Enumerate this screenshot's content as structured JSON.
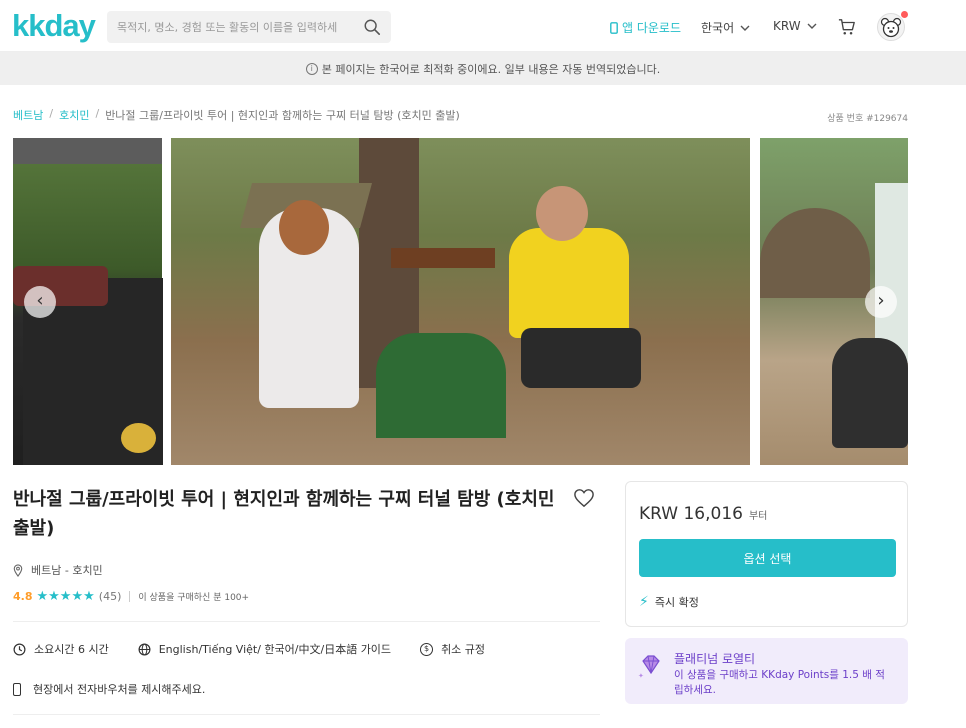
{
  "header": {
    "logo": "kkday",
    "search_placeholder": "목적지, 명소, 경험 또는 활동의 이름을 입력하세",
    "app_download": "앱 다운로드",
    "language": "한국어",
    "currency": "KRW",
    "icons": [
      "search-icon",
      "phone-icon",
      "chevron-down-icon",
      "cart-icon",
      "avatar-bear-icon"
    ]
  },
  "notice": "본 페이지는 한국어로 최적화 중이에요. 일부 내용은 자동 번역되었습니다.",
  "breadcrumb": {
    "items": [
      "베트남",
      "호치민",
      "반나절 그룹/프라이빗 투어 | 현지인과 함께하는 구찌 터널 탐방 (호치민 출발)"
    ],
    "separator": "/"
  },
  "product_no": "상품 번호 #129674",
  "gallery": {
    "prev": "‹",
    "next": "›"
  },
  "product": {
    "title": "반나절 그룹/프라이빗 투어 | 현지인과 함께하는 구찌 터널 탐방 (호치민 출발)",
    "location": "베트남 - 호치민",
    "rating": "4.8",
    "stars": "★★★★★",
    "reviews": "(45)",
    "sold": "이 상품을 구매하신 분 100+",
    "duration": "소요시간 6 시간",
    "guide": "English/Tiếng Việt/ 한국어/中文/日本語 가이드",
    "cancel": "취소 규정",
    "eticket": "현장에서 전자바우처를 제시해주세요."
  },
  "price_card": {
    "price": "KRW 16,016",
    "from": "부터",
    "cta": "옵션 선택",
    "instant": "즉시 확정"
  },
  "loyalty": {
    "title": "플래티넘 로열티",
    "text": "이 상품을 구매하고 KKday Points를 1.5 배 적립하세요."
  },
  "colors": {
    "brand": "#26bec9",
    "rating": "#ff9d2a",
    "loyalty_bg": "#f1ecfb",
    "loyalty_text": "#6c3fc9"
  }
}
